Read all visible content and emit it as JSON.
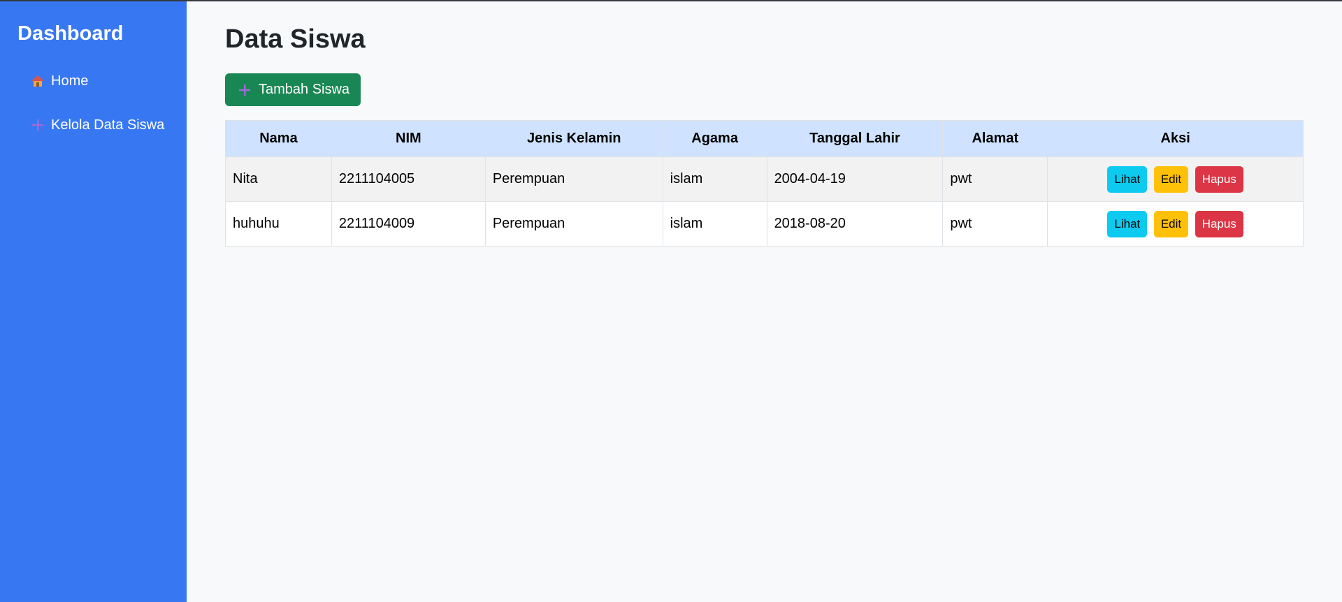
{
  "sidebar": {
    "title": "Dashboard",
    "items": [
      {
        "label": "Home",
        "icon": "house-icon"
      },
      {
        "label": "Kelola Data Siswa",
        "icon": "plus-icon"
      }
    ]
  },
  "main": {
    "title": "Data Siswa",
    "add_button": {
      "label": "Tambah Siswa",
      "icon": "plus-icon"
    },
    "table": {
      "headers": [
        "Nama",
        "NIM",
        "Jenis Kelamin",
        "Agama",
        "Tanggal Lahir",
        "Alamat",
        "Aksi"
      ],
      "rows": [
        {
          "nama": "Nita",
          "nim": "2211104005",
          "jenis_kelamin": "Perempuan",
          "agama": "islam",
          "tanggal_lahir": "2004-04-19",
          "alamat": "pwt"
        },
        {
          "nama": "huhuhu",
          "nim": "2211104009",
          "jenis_kelamin": "Perempuan",
          "agama": "islam",
          "tanggal_lahir": "2018-08-20",
          "alamat": "pwt"
        }
      ],
      "actions": {
        "view": "Lihat",
        "edit": "Edit",
        "delete": "Hapus"
      }
    }
  },
  "colors": {
    "sidebar": "#3777f1",
    "add_button": "#198754",
    "header_row": "#cfe2ff",
    "view": "#0dcaf0",
    "edit": "#ffc107",
    "delete": "#dc3545"
  }
}
